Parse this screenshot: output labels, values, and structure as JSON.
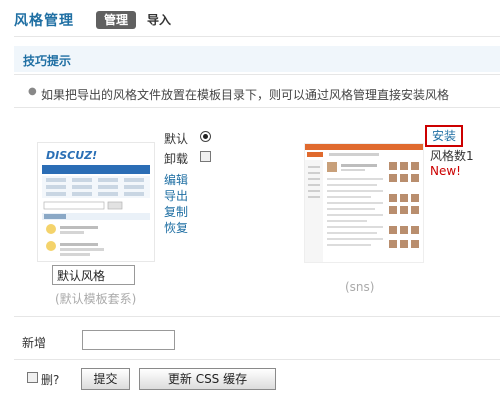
{
  "header": {
    "title": "风格管理",
    "tabs": [
      "管理",
      "导入"
    ]
  },
  "tips": {
    "title": "技巧提示",
    "items": [
      "如果把导出的风格文件放置在模板目录下，则可以通过风格管理直接安装风格"
    ]
  },
  "styles": [
    {
      "name": "默认风格",
      "template_set": "(默认模板套系)",
      "thumbnail_logo": "DISCUZ!",
      "default_label": "默认",
      "uninstall_label": "卸载",
      "actions": [
        "编辑",
        "导出",
        "复制",
        "恢复"
      ],
      "is_default": true
    },
    {
      "template_set": "(sns)",
      "install_label": "安装",
      "count_text": "风格数1",
      "new_badge": "New!"
    }
  ],
  "form": {
    "add_label": "新增",
    "add_value": "",
    "delete_label": "删?",
    "submit_label": "提交",
    "update_css_label": "更新 CSS 缓存"
  },
  "colors": {
    "accent": "#1f6fa3",
    "tab_active_bg": "#606060",
    "alert": "#cc0000"
  }
}
